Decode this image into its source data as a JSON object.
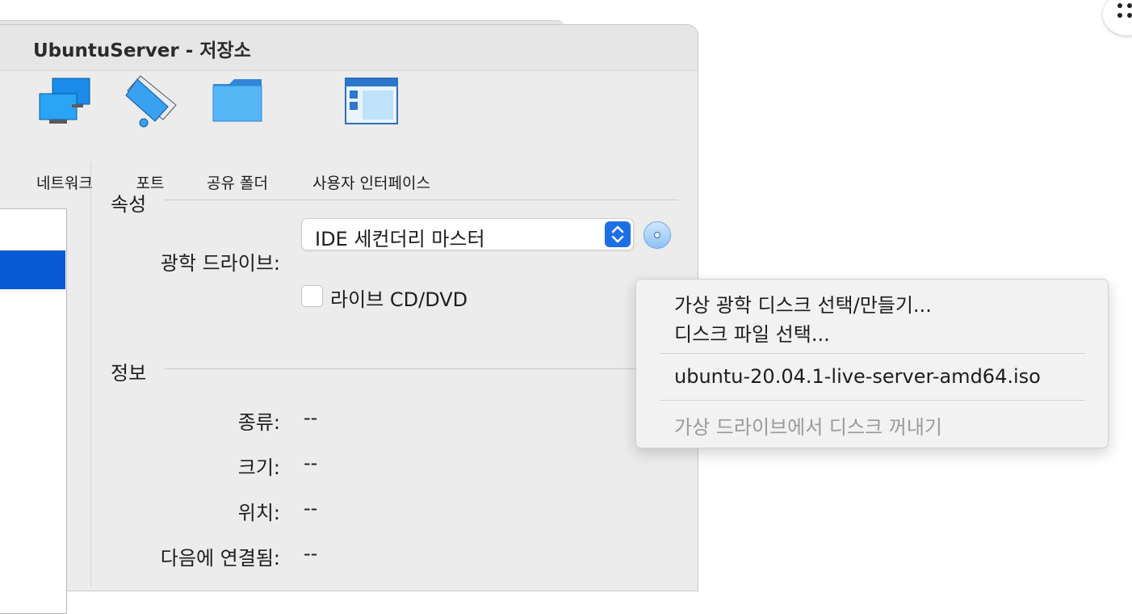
{
  "window": {
    "title": "UbuntuServer - 저장소"
  },
  "toolbar": {
    "items": [
      {
        "label": "네트워크",
        "icon": "network-icon"
      },
      {
        "label": "포트",
        "icon": "port-icon"
      },
      {
        "label": "공유 폴더",
        "icon": "shared-folder-icon"
      },
      {
        "label": "사용자 인터페이스",
        "icon": "user-interface-icon"
      }
    ]
  },
  "attributes": {
    "section_title": "속성",
    "optical_drive_label": "광학 드라이브:",
    "optical_drive_value": "IDE 세컨더리 마스터",
    "live_cd_label": "라이브 CD/DVD",
    "live_cd_checked": false
  },
  "info": {
    "section_title": "정보",
    "rows": [
      {
        "label": "종류:",
        "value": "--"
      },
      {
        "label": "크기:",
        "value": "--"
      },
      {
        "label": "위치:",
        "value": "--"
      },
      {
        "label": "다음에 연결됨:",
        "value": "--"
      }
    ]
  },
  "menu": {
    "items": [
      {
        "label": "가상 광학 디스크 선택/만들기...",
        "enabled": true
      },
      {
        "label": "디스크 파일 선택...",
        "enabled": true
      },
      {
        "label": "ubuntu-20.04.1-live-server-amd64.iso",
        "enabled": true
      },
      {
        "label": "가상 드라이브에서 디스크 꺼내기",
        "enabled": false
      }
    ]
  },
  "colors": {
    "selection_blue": "#0a5ad6",
    "stepper_blue": "#1d6fe6"
  }
}
